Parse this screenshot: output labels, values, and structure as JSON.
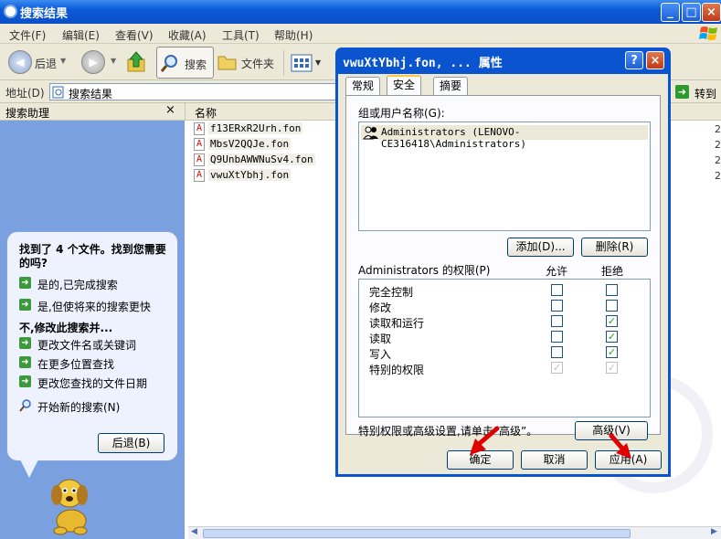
{
  "window": {
    "title": "搜索结果",
    "controls": {
      "minimize": "_",
      "maximize": "□",
      "close": "×"
    }
  },
  "menu": [
    "文件(F)",
    "编辑(E)",
    "查看(V)",
    "收藏(A)",
    "工具(T)",
    "帮助(H)"
  ],
  "toolbar": {
    "back_label": "后退",
    "search_label": "搜索",
    "folders_label": "文件夹"
  },
  "address": {
    "label": "地址(D)",
    "value": "搜索结果",
    "go_label": "转到"
  },
  "left_panel": {
    "title": "搜索助理",
    "close_label": "×",
    "found_text": "找到了 4 个文件。找到您需要的吗?",
    "options_yes": [
      "是的,已完成搜索",
      "是,但使将来的搜索更快"
    ],
    "modify_heading": "不,修改此搜索并...",
    "options_modify": [
      "更改文件名或关键词",
      "在更多位置查找",
      "更改您查找的文件日期"
    ],
    "new_search": "开始新的搜索(N)",
    "back_button": "后退(B)"
  },
  "file_list": {
    "column_name": "名称",
    "files": [
      "f13ERxR2Urh.fon",
      "MbsV2QQJe.fon",
      "Q9UnbAWWNuSv4.fon",
      "vwuXtYbhj.fon"
    ],
    "right_col": [
      "2",
      "2",
      "2",
      "2"
    ]
  },
  "dialog": {
    "title": "vwuXtYbhj.fon, ... 属性",
    "help": "?",
    "close": "×",
    "tabs": [
      "常规",
      "安全",
      "摘要"
    ],
    "active_tab": "安全",
    "groups_label": "组或用户名称(G):",
    "users": [
      "Administrators (LENOVO-CE316418\\Administrators)"
    ],
    "add_button": "添加(D)...",
    "remove_button": "删除(R)",
    "perm_label": "Administrators 的权限(P)",
    "allow_label": "允许",
    "deny_label": "拒绝",
    "permissions": [
      {
        "name": "完全控制",
        "allow": false,
        "deny": false,
        "disabled": false
      },
      {
        "name": "修改",
        "allow": false,
        "deny": false,
        "disabled": false
      },
      {
        "name": "读取和运行",
        "allow": false,
        "deny": true,
        "disabled": false
      },
      {
        "name": "读取",
        "allow": false,
        "deny": true,
        "disabled": false
      },
      {
        "name": "写入",
        "allow": false,
        "deny": true,
        "disabled": false
      },
      {
        "name": "特别的权限",
        "allow": true,
        "deny": true,
        "disabled": true
      }
    ],
    "advanced_hint": "特别权限或高级设置,请单击“高级”。",
    "advanced_button": "高级(V)",
    "ok_button": "确定",
    "cancel_button": "取消",
    "apply_button": "应用(A)"
  },
  "colors": {
    "xp_blue": "#0a54d0",
    "panel_blue": "#7ba0e0",
    "annotation_red": "#e00000"
  }
}
